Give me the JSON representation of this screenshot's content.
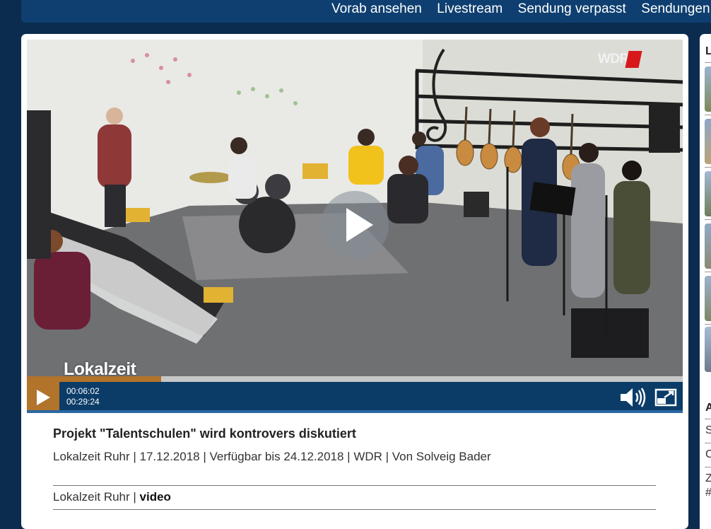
{
  "nav": {
    "items": [
      "Vorab ansehen",
      "Livestream",
      "Sendung verpasst",
      "Sendungen A-Z"
    ]
  },
  "player": {
    "logo_text": "Lokalzeit",
    "channel_logo": "WDR",
    "current_time": "00:06:02",
    "duration": "00:29:24",
    "progress_fraction": 0.205,
    "accent_color": "#b2732b",
    "bar_color": "#0b3c68"
  },
  "video": {
    "title": "Projekt \"Talentschulen\" wird kontrovers diskutiert",
    "meta": "Lokalzeit Ruhr | 17.12.2018 | Verfügbar bis 24.12.2018 | WDR | Von Solveig Bader",
    "tag_prefix": "Lokalzeit Ruhr | ",
    "tag_type": "video"
  },
  "sidebar": {
    "heading_top": "L",
    "heading_bottom": "A",
    "items": [
      "S",
      "C",
      "Z",
      "#"
    ]
  }
}
